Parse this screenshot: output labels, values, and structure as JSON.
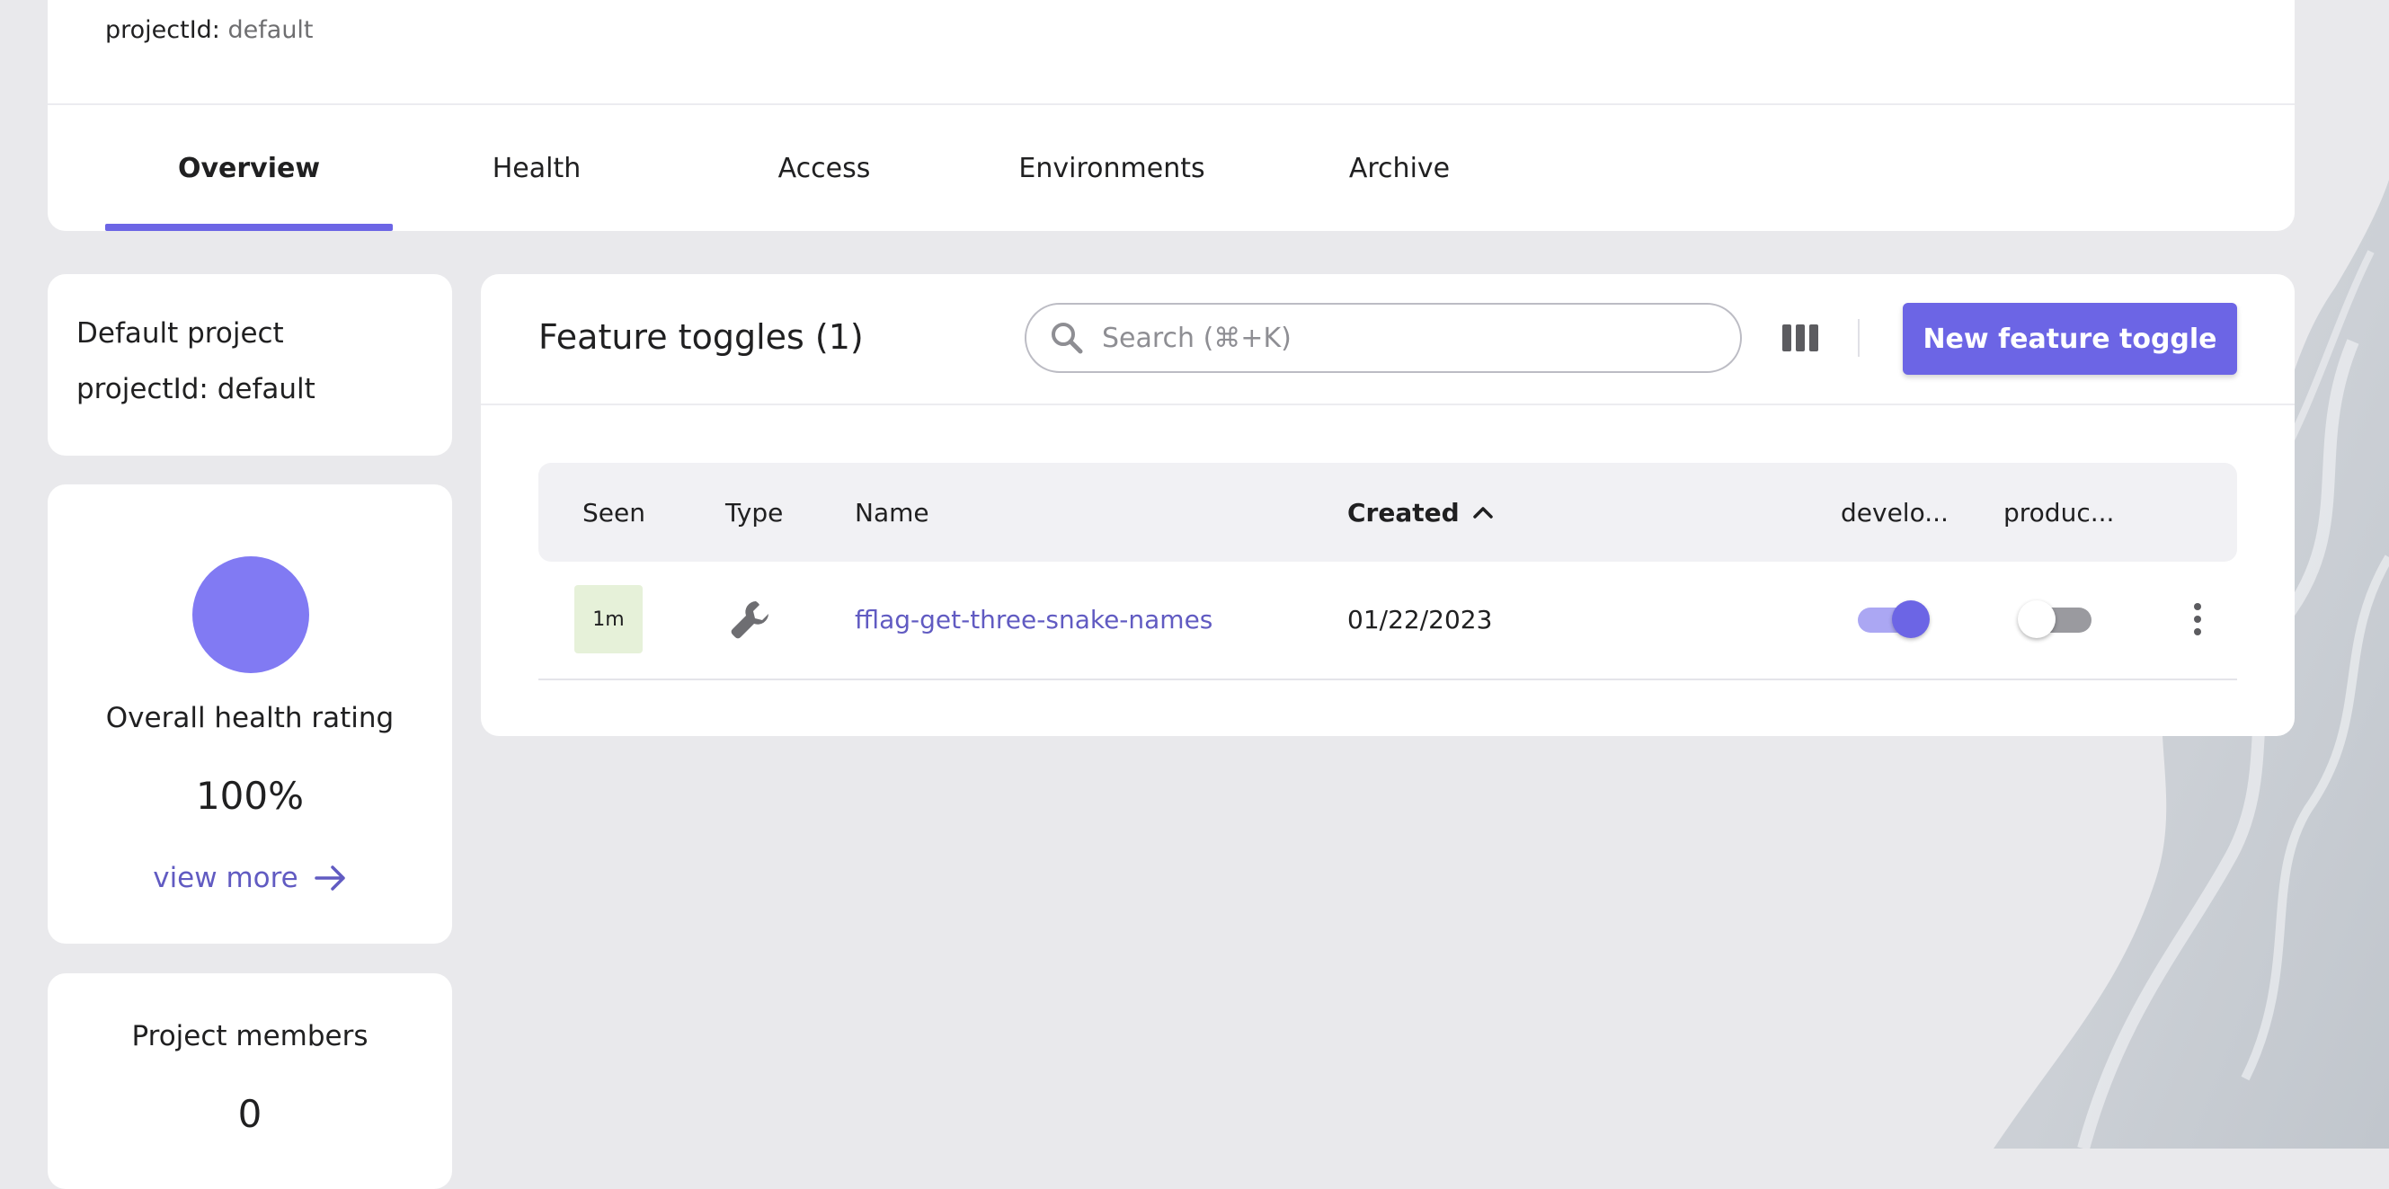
{
  "header": {
    "project_id_key": "projectId:",
    "project_id_value": "default",
    "tabs": [
      {
        "label": "Overview",
        "active": true
      },
      {
        "label": "Health",
        "active": false
      },
      {
        "label": "Access",
        "active": false
      },
      {
        "label": "Environments",
        "active": false
      },
      {
        "label": "Archive",
        "active": false
      }
    ]
  },
  "info": {
    "name": "Default project",
    "project_id": "projectId: default"
  },
  "health": {
    "label": "Overall health rating",
    "value": "100%",
    "view_more": "view more"
  },
  "members": {
    "label": "Project members",
    "value": "0"
  },
  "toggles": {
    "title": "Feature toggles (1)",
    "search_placeholder": "Search (⌘+K)",
    "new_button": "New feature toggle",
    "columns": {
      "seen": "Seen",
      "type": "Type",
      "name": "Name",
      "created": "Created",
      "development": "develo...",
      "production": "produc..."
    },
    "rows": [
      {
        "seen": "1m",
        "type_icon": "wrench-icon",
        "name": "fflag-get-three-snake-names",
        "created": "01/22/2023",
        "development_enabled": true,
        "production_enabled": false
      }
    ]
  },
  "colors": {
    "accent": "#6c65e5",
    "health_circle": "#817af3",
    "link": "#615bc2",
    "seen_badge": "#e6f1d9"
  }
}
